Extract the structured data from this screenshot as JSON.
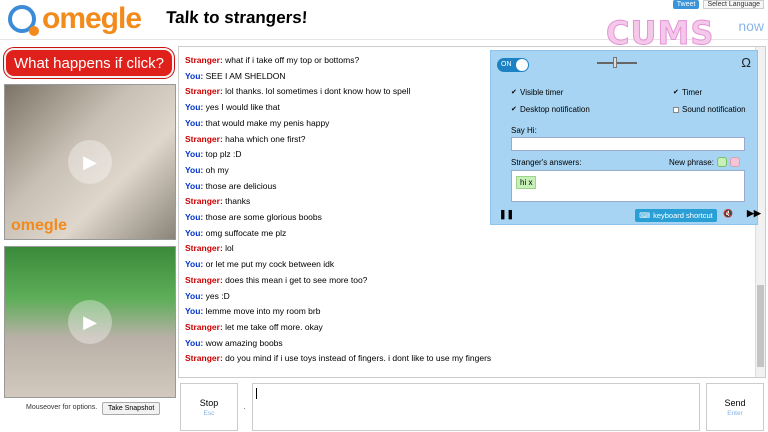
{
  "header": {
    "logo_text": "omegle",
    "tagline": "Talk to strangers!",
    "tweet_label": "Tweet",
    "language_label": "Select Language",
    "now_text": "now",
    "watermark": "CUMS"
  },
  "sidebar": {
    "promo_button": "What happens if click?",
    "video_watermark": "omegle",
    "mouseover_note": "Mouseover for options.",
    "snapshot_button": "Take Snapshot"
  },
  "chat": {
    "stranger_label": "Stranger:",
    "you_label": "You:",
    "messages": [
      {
        "who": "Stranger",
        "text": "what if i take off my top or bottoms?"
      },
      {
        "who": "You",
        "text": "SEE I AM SHELDON"
      },
      {
        "who": "Stranger",
        "text": "lol thanks. lol sometimes i dont know how to spell"
      },
      {
        "who": "You",
        "text": "yes I would like that"
      },
      {
        "who": "You",
        "text": "that would make my penis happy"
      },
      {
        "who": "Stranger",
        "text": "haha which one first?"
      },
      {
        "who": "You",
        "text": "top plz :D"
      },
      {
        "who": "You",
        "text": "oh my"
      },
      {
        "who": "You",
        "text": "those are delicious"
      },
      {
        "who": "Stranger",
        "text": "thanks"
      },
      {
        "who": "You",
        "text": "those are some glorious boobs"
      },
      {
        "who": "You",
        "text": "omg suffocate me plz"
      },
      {
        "who": "Stranger",
        "text": "lol"
      },
      {
        "who": "You",
        "text": "or let me put my cock between idk"
      },
      {
        "who": "Stranger",
        "text": "does this mean i get to see more too?"
      },
      {
        "who": "You",
        "text": "yes :D"
      },
      {
        "who": "You",
        "text": "lemme move into my room brb"
      },
      {
        "who": "Stranger",
        "text": "let me take off more. okay"
      },
      {
        "who": "You",
        "text": "wow amazing boobs"
      },
      {
        "who": "Stranger",
        "text": "do you mind if i use toys instead of fingers. i dont like to use my fingers"
      }
    ]
  },
  "panel": {
    "toggle_label": "ON",
    "omega_symbol": "Ω",
    "visible_timer": "Visible timer",
    "timer": "Timer",
    "desktop_notification": "Desktop notification",
    "sound_notification": "Sound notification",
    "say_hi_label": "Say Hi:",
    "say_hi_value": "",
    "answers_label": "Stranger's answers:",
    "new_phrase_label": "New phrase:",
    "answer_tag": "hi x",
    "keyboard_shortcut": "keyboard shortcut",
    "colors": {
      "panel_bg": "#a7d4f3",
      "accent": "#2a9fd6",
      "phrase_green": "#c6f0b8",
      "phrase_pink": "#f6c6d6"
    }
  },
  "footer": {
    "stop_label": "Stop",
    "stop_key": "Esc",
    "send_label": "Send",
    "send_key": "Enter",
    "message_value": ""
  }
}
